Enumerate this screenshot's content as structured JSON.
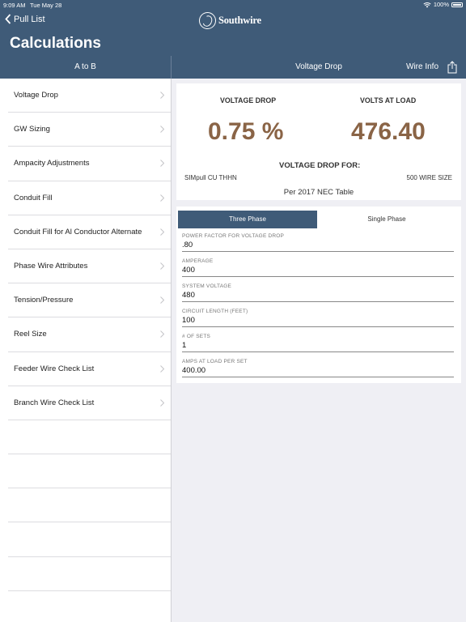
{
  "status": {
    "time": "9:09 AM",
    "date": "Tue May 28",
    "battery": "100%"
  },
  "nav": {
    "back_label": "Pull List",
    "logo_text": "Southwire",
    "title": "Calculations"
  },
  "left_header": {
    "label": "A to B"
  },
  "right_header": {
    "title": "Voltage Drop",
    "wire_info": "Wire Info"
  },
  "menu": [
    {
      "label": "Voltage Drop"
    },
    {
      "label": "GW Sizing"
    },
    {
      "label": "Ampacity Adjustments"
    },
    {
      "label": "Conduit Fill"
    },
    {
      "label": "Conduit Fill for Al Conductor Alternate"
    },
    {
      "label": "Phase Wire Attributes"
    },
    {
      "label": "Tension/Pressure"
    },
    {
      "label": "Reel Size"
    },
    {
      "label": "Feeder Wire Check List"
    },
    {
      "label": "Branch Wire Check List"
    }
  ],
  "results": {
    "voltage_drop_label": "VOLTAGE DROP",
    "volts_at_load_label": "VOLTS AT LOAD",
    "voltage_drop_value": "0.75 %",
    "volts_at_load_value": "476.40",
    "drop_for_label": "VOLTAGE DROP FOR:",
    "wire_type": "SIMpull CU THHN",
    "wire_size": "500 WIRE SIZE",
    "table_note": "Per 2017 NEC Table"
  },
  "phase": {
    "three": "Three Phase",
    "single": "Single Phase",
    "selected": "three"
  },
  "fields": [
    {
      "label": "POWER FACTOR FOR VOLTAGE DROP",
      "value": ".80"
    },
    {
      "label": "AMPERAGE",
      "value": "400"
    },
    {
      "label": "SYSTEM VOLTAGE",
      "value": "480"
    },
    {
      "label": "CIRCUIT LENGTH (FEET)",
      "value": "100"
    },
    {
      "label": "# OF SETS",
      "value": "1"
    },
    {
      "label": "AMPS AT LOAD PER SET",
      "value": "400.00"
    }
  ],
  "colors": {
    "header": "#3f5b78",
    "accent_value": "#8a6446"
  }
}
